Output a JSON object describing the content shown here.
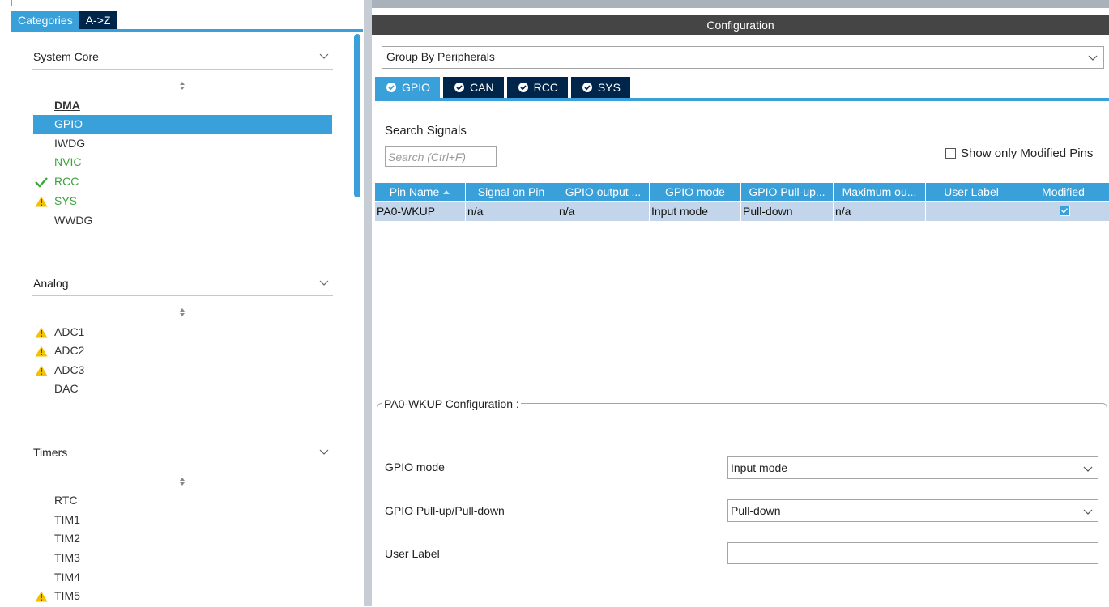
{
  "left": {
    "tabs": [
      {
        "label": "Categories",
        "active": true
      },
      {
        "label": "A->Z",
        "active": false
      }
    ],
    "categories": [
      {
        "title": "System Core",
        "items": [
          {
            "label": "DMA",
            "style": "bold"
          },
          {
            "label": "GPIO",
            "style": "selected"
          },
          {
            "label": "IWDG",
            "style": "normal"
          },
          {
            "label": "NVIC",
            "style": "green"
          },
          {
            "label": "RCC",
            "style": "green",
            "icon": "check-icon"
          },
          {
            "label": "SYS",
            "style": "green",
            "icon": "warning-icon"
          },
          {
            "label": "WWDG",
            "style": "normal"
          }
        ]
      },
      {
        "title": "Analog",
        "items": [
          {
            "label": "ADC1",
            "icon": "warning-icon"
          },
          {
            "label": "ADC2",
            "icon": "warning-icon"
          },
          {
            "label": "ADC3",
            "icon": "warning-icon"
          },
          {
            "label": "DAC"
          }
        ]
      },
      {
        "title": "Timers",
        "items": [
          {
            "label": "RTC"
          },
          {
            "label": "TIM1"
          },
          {
            "label": "TIM2"
          },
          {
            "label": "TIM3"
          },
          {
            "label": "TIM4"
          },
          {
            "label": "TIM5",
            "icon": "warning-icon"
          }
        ]
      }
    ]
  },
  "config": {
    "title": "Configuration",
    "group_by": "Group By Peripherals",
    "tabs": [
      {
        "label": "GPIO",
        "active": true
      },
      {
        "label": "CAN",
        "active": false
      },
      {
        "label": "RCC",
        "active": false
      },
      {
        "label": "SYS",
        "active": false
      }
    ],
    "search_label": "Search Signals",
    "search_placeholder": "Search (Ctrl+F)",
    "show_modified_label": "Show only Modified Pins",
    "show_modified_checked": false,
    "table": {
      "columns": [
        "Pin Name",
        "Signal on Pin",
        "GPIO output ...",
        "GPIO mode",
        "GPIO Pull-up...",
        "Maximum ou...",
        "User Label",
        "Modified"
      ],
      "rows": [
        {
          "pin": "PA0-WKUP",
          "signal": "n/a",
          "output": "n/a",
          "mode": "Input mode",
          "pull": "Pull-down",
          "max": "n/a",
          "user_label": "",
          "modified": true
        }
      ]
    },
    "pin_config": {
      "legend": "PA0-WKUP Configuration :",
      "fields": [
        {
          "label": "GPIO mode",
          "value": "Input mode"
        },
        {
          "label": "GPIO Pull-up/Pull-down",
          "value": "Pull-down"
        },
        {
          "label": "User Label",
          "value": ""
        }
      ]
    }
  },
  "colors": {
    "accent": "#39a0da",
    "dark_tab": "#00254a",
    "title_bar": "#454545",
    "row_selected": "#c3d5ea",
    "green": "#3aa63a",
    "warning": "#f2c200"
  }
}
